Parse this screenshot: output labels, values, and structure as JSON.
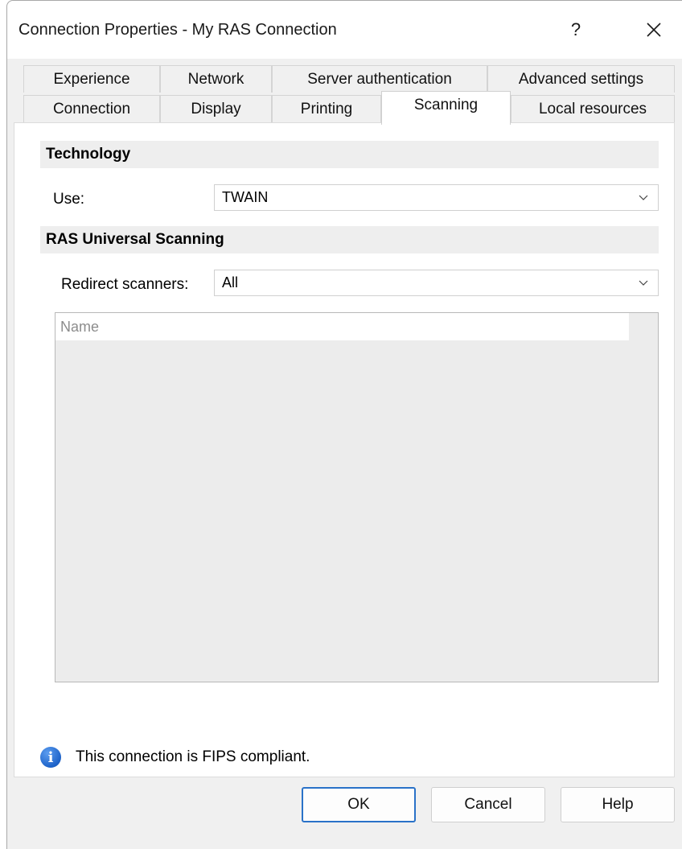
{
  "window": {
    "title": "Connection Properties - My RAS Connection",
    "help_glyph": "?",
    "close_glyph": "✕"
  },
  "tabs": {
    "row_back": [
      "Experience",
      "Network",
      "Server authentication",
      "Advanced settings"
    ],
    "row_front": [
      "Connection",
      "Display",
      "Printing",
      "Scanning",
      "Local resources"
    ],
    "active": "Scanning"
  },
  "technology": {
    "header": "Technology",
    "use_label": "Use:",
    "use_value": "TWAIN"
  },
  "universal_scanning": {
    "header": "RAS Universal Scanning",
    "redirect_label": "Redirect scanners:",
    "redirect_value": "All",
    "list_column": "Name"
  },
  "info": {
    "icon": "info-icon",
    "text": "This connection is FIPS compliant."
  },
  "buttons": {
    "ok": "OK",
    "cancel": "Cancel",
    "help": "Help"
  },
  "colors": {
    "accent": "#2a72c8",
    "info_icon": "#1e63c9"
  }
}
